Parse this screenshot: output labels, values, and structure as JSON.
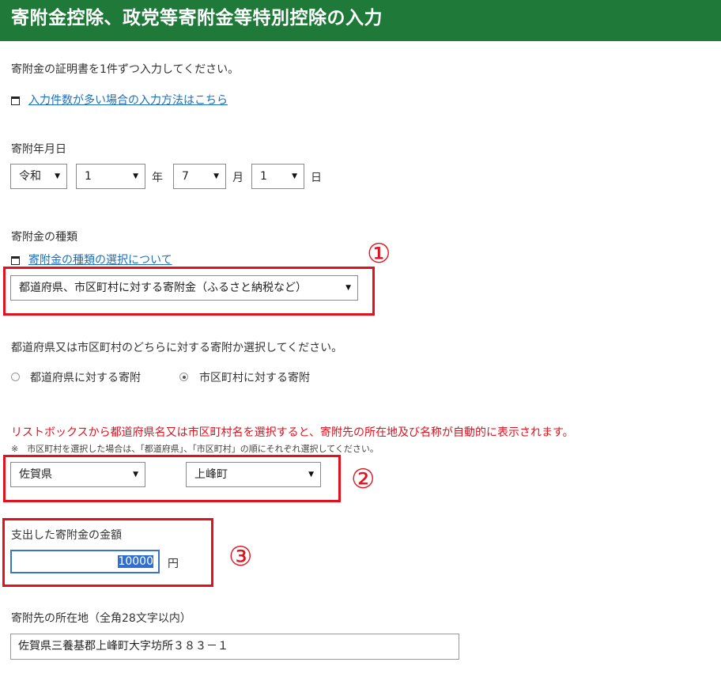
{
  "header": {
    "title": "寄附金控除、政党等寄附金等特別控除の入力"
  },
  "intro": {
    "text": "寄附金の証明書を1件ずつ入力してください。",
    "link": "入力件数が多い場合の入力方法はこちら"
  },
  "date": {
    "label": "寄附年月日",
    "era": "令和",
    "year": "1",
    "year_unit": "年",
    "month": "7",
    "month_unit": "月",
    "day": "1",
    "day_unit": "日"
  },
  "kind": {
    "label": "寄附金の種類",
    "link": "寄附金の種類の選択について",
    "selected": "都道府県、市区町村に対する寄附金（ふるさと納税など）"
  },
  "target": {
    "question": "都道府県又は市区町村のどちらに対する寄附か選択してください。",
    "option_pref": "都道府県に対する寄附",
    "option_city": "市区町村に対する寄附",
    "selected": "option_city"
  },
  "location": {
    "info": "リストボックスから都道府県名又は市区町村名を選択すると、寄附先の所在地及び名称が自動的に表示されます。",
    "note": "※　市区町村を選択した場合は、「都道府県」、「市区町村」の順にそれぞれ選択してください。",
    "prefecture": "佐賀県",
    "city": "上峰町"
  },
  "amount": {
    "label": "支出した寄附金の金額",
    "value": "10000",
    "unit": "円"
  },
  "address": {
    "label": "寄附先の所在地（全角28文字以内）",
    "value": "佐賀県三養基郡上峰町大字坊所３８３－１"
  },
  "annotations": {
    "n1": "①",
    "n2": "②",
    "n3": "③"
  },
  "colors": {
    "header": "#1f7a3a",
    "highlight": "#e0121e",
    "link": "#1c6fbf"
  }
}
